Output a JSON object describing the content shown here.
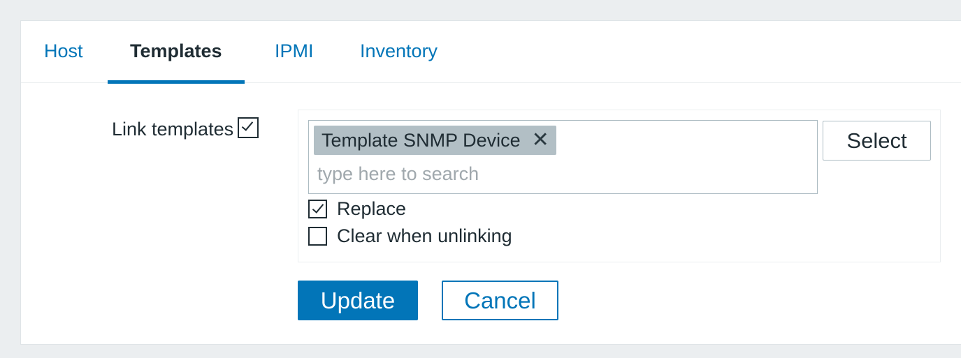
{
  "tabs": [
    {
      "label": "Host",
      "active": false
    },
    {
      "label": "Templates",
      "active": true
    },
    {
      "label": "IPMI",
      "active": false
    },
    {
      "label": "Inventory",
      "active": false
    }
  ],
  "form": {
    "link_templates_label": "Link templates",
    "link_templates_checked": true,
    "selected_templates": [
      {
        "name": "Template SNMP Device",
        "remove_icon": "close-icon"
      }
    ],
    "search_placeholder": "type here to search",
    "select_button_label": "Select",
    "options": {
      "replace_label": "Replace",
      "replace_checked": true,
      "clear_label": "Clear when unlinking",
      "clear_checked": false
    }
  },
  "actions": {
    "update_label": "Update",
    "cancel_label": "Cancel"
  },
  "colors": {
    "accent": "#0275b8",
    "background": "#ebeef0",
    "chip": "#b2bfc5",
    "text": "#1f2c33"
  }
}
